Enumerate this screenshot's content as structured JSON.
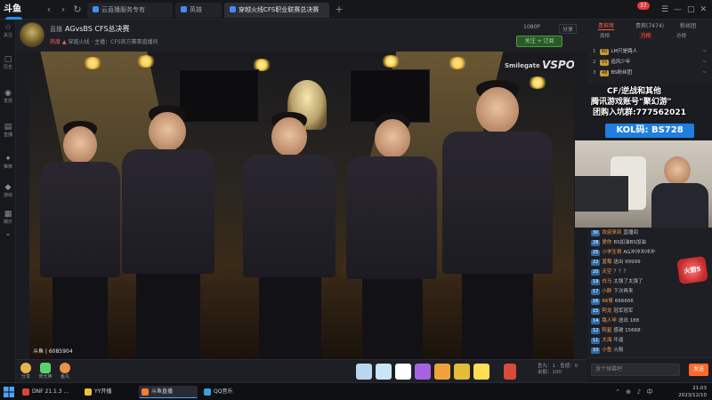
{
  "app": {
    "logo_text": "斗鱼",
    "logo_sub": "DY"
  },
  "tabs": [
    {
      "label": "云直播服务专有"
    },
    {
      "label": "英雄"
    },
    {
      "label": "穿越火线CFS职业联赛总决赛"
    }
  ],
  "window": {
    "notif_count": "37",
    "controls": [
      "☰",
      "—",
      "□",
      "✕"
    ]
  },
  "rail": [
    {
      "icon": "☆",
      "label": "关注"
    },
    {
      "icon": "▢",
      "label": "历史"
    },
    {
      "icon": "◉",
      "label": "发现"
    },
    {
      "icon": "▤",
      "label": "直播"
    },
    {
      "icon": "✦",
      "label": "推荐"
    },
    {
      "icon": "◆",
      "label": "游戏"
    },
    {
      "icon": "▦",
      "label": "娱乐"
    },
    {
      "icon": "⌄",
      "label": ""
    }
  ],
  "room": {
    "tag": "直播",
    "title": "AGvsBS CFS总决赛",
    "sub_text": "穿越火线 · 主播：CFS官方赛事直播间",
    "hot": "热度 ▲",
    "quality": "1080P",
    "share": "分享",
    "follow_label": "关注 + 订阅"
  },
  "video": {
    "sponsor_small": "Smilegate",
    "sponsor_big": "VSPO",
    "watermark": "斗鱼 | 6085904"
  },
  "overlay": {
    "line1": "CF/逆战和其他",
    "line2": "腾讯游戏账号\"聚幻游\"",
    "line3": "团购入坑群:777562021",
    "kol": "KOL码: BS728"
  },
  "rank": {
    "tabs": [
      "贵宾席",
      "贵宾(7474)",
      "粉丝团"
    ],
    "subtabs": [
      "周榜",
      "月榜",
      "总榜"
    ],
    "rows": [
      {
        "n": "1",
        "lv": "60",
        "name": "LM只是路人",
        "score": "~"
      },
      {
        "n": "2",
        "lv": "55",
        "name": "追风少年",
        "score": "~"
      },
      {
        "n": "3",
        "lv": "48",
        "name": "BS粉丝团",
        "score": "~"
      },
      {
        "n": "4",
        "lv": "42",
        "name": "CFer永远的",
        "score": "~"
      }
    ]
  },
  "chat": {
    "messages": [
      {
        "lv": "30",
        "user": "欢迎来到",
        "text": "直播间"
      },
      {
        "lv": "28",
        "user": "爱你",
        "text": "BS加油BS加油"
      },
      {
        "lv": "25",
        "user": "小学生哥",
        "text": "AG冲冲冲冲冲"
      },
      {
        "lv": "22",
        "user": "蓝莓",
        "text": "送出 99999"
      },
      {
        "lv": "20",
        "user": "天空",
        "text": "？？？"
      },
      {
        "lv": "19",
        "user": "白马",
        "text": "太强了太强了"
      },
      {
        "lv": "17",
        "user": "小胖",
        "text": "下次再来"
      },
      {
        "lv": "16",
        "user": "66哥",
        "text": "666666"
      },
      {
        "lv": "15",
        "user": "阿龙",
        "text": "冠军冠军"
      },
      {
        "lv": "14",
        "user": "路人甲",
        "text": "送出 188"
      },
      {
        "lv": "12",
        "user": "阿星",
        "text": "感谢 15668"
      },
      {
        "lv": "11",
        "user": "大海",
        "text": "牛逼"
      },
      {
        "lv": "10",
        "user": "小鱼",
        "text": "火箭"
      }
    ],
    "gift_badge": "火箭5",
    "input_placeholder": "发个弹幕吧",
    "send_label": "发送"
  },
  "giftbar": {
    "left_labels": [
      "分享",
      "荧光棒",
      "鱼丸"
    ],
    "info_line1": "鱼丸：1 · 鱼翅：0",
    "info_line2": "余额：100"
  },
  "taskbar": {
    "items": [
      {
        "label": "DNF 21.1.3 ..."
      },
      {
        "label": "YY开播"
      },
      {
        "label": "斗鱼直播"
      },
      {
        "label": "QQ音乐"
      }
    ],
    "time": "21:03",
    "date": "2023/12/10"
  },
  "colors": {
    "accent": "#1f8ff0",
    "hot": "#ff5a4a",
    "kol_bg": "#1f7fe0"
  }
}
